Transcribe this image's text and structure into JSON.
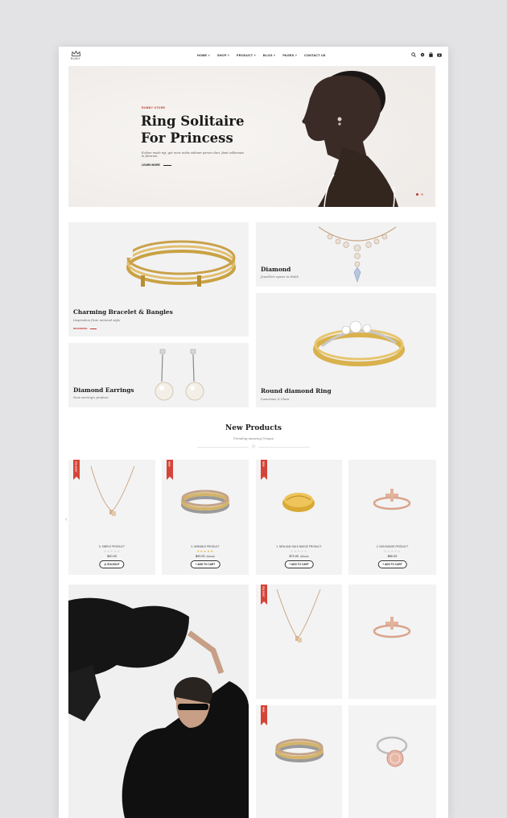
{
  "brand": {
    "logo_text": "RUBY"
  },
  "nav": {
    "items": [
      "HOME ˅",
      "SHOP ˅",
      "PRODUCT ˅",
      "BLOG ˅",
      "PAGES ˅",
      "CONTACT US"
    ]
  },
  "header_icons": [
    "search-icon",
    "settings-icon",
    "bag-icon",
    "cart-icon"
  ],
  "hero": {
    "kicker": "RUBBY STORE",
    "title_line1": "Ring Solitaire",
    "title_line2": "For Princess",
    "subtitle": "Ecdom mode nyt, get nunc nobis vidimar parum clari, fiant sollemnes in futurum.",
    "cta": "LEARN MORE"
  },
  "banners": {
    "bracelet": {
      "title": "Charming Bracelet & Bangles",
      "subtitle": "Inspiration from minimal style",
      "cta": "READMORE"
    },
    "diamond": {
      "title": "Diamond",
      "subtitle": "Jewellers opens in Hubli"
    },
    "earrings": {
      "title": "Diamond Earrings",
      "subtitle": "New earring's product"
    },
    "ring": {
      "title": "Round diamond Ring",
      "subtitle": "Luxurious & Class"
    }
  },
  "new_products": {
    "title": "New Products",
    "subtitle": "Trending amazing Unique",
    "items": [
      {
        "badge": "SOLDOUT",
        "name": "5. SIMPLE PRODUCT",
        "stars": "★★★★★",
        "price": "$20.00",
        "old_price": "",
        "button": "☑ SOLDOUT"
      },
      {
        "badge": "NEW",
        "name": "3. VARIABLE PRODUCT",
        "stars": "★★★★★",
        "price": "$20.00",
        "old_price": "$25.00",
        "button": "+ ADD TO CART"
      },
      {
        "badge": "NEW",
        "name": "1. NEW AND SALE BADGE PRODUCT",
        "stars": "★★★★★",
        "price": "$70.00",
        "old_price": "$80.00",
        "button": "+ ADD TO CART"
      },
      {
        "badge": "",
        "name": "2. NON BADGE PRODUCT",
        "stars": "★★★★★",
        "price": "$80.00",
        "old_price": "",
        "button": "+ ADD TO CART"
      }
    ],
    "prev": "‹",
    "next": "›"
  },
  "grid_products": [
    {
      "badge": "SOLDOUT"
    },
    {
      "badge": ""
    },
    {
      "badge": "NEW"
    },
    {
      "badge": ""
    }
  ],
  "colors": {
    "accent": "#c2372d",
    "tile_bg": "#f2f2f3",
    "page_bg": "#e3e3e5"
  }
}
